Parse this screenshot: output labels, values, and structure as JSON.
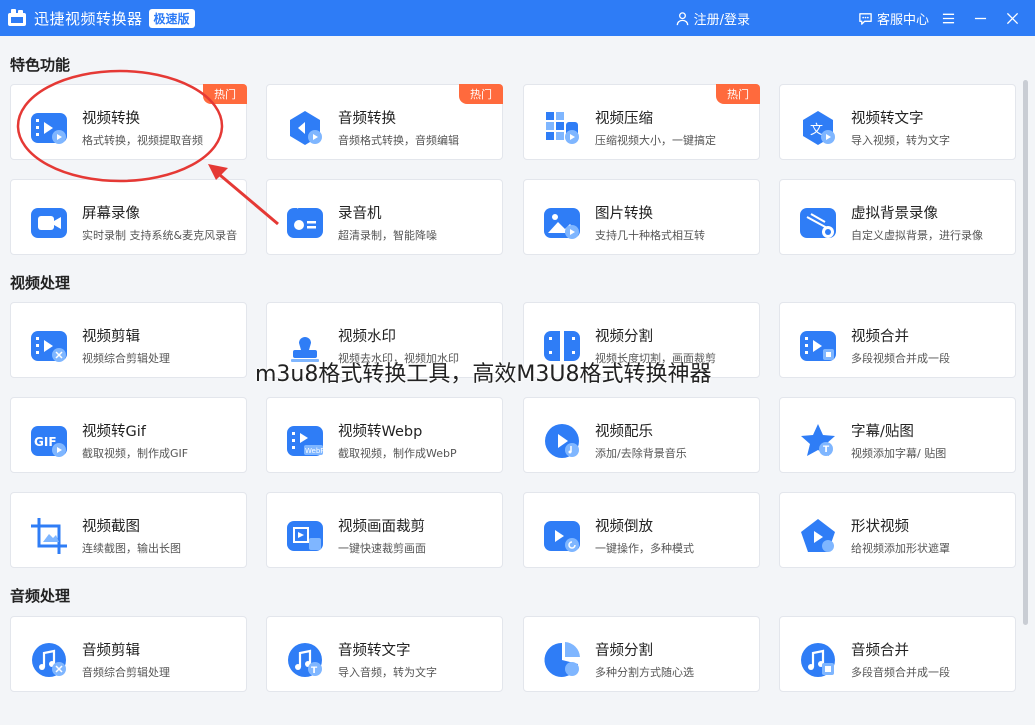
{
  "titlebar": {
    "app_title": "迅捷视频转换器",
    "edition": "极速版",
    "login": "注册/登录",
    "service": "客服中心"
  },
  "sections": {
    "featured": "特色功能",
    "video": "视频处理",
    "audio": "音频处理"
  },
  "hot_label": "热门",
  "cards": [
    {
      "name": "视频转换",
      "desc": "格式转换，视频提取音频",
      "icon": "video-convert-icon",
      "hot": true
    },
    {
      "name": "音频转换",
      "desc": "音频格式转换，音频编辑",
      "icon": "audio-convert-icon",
      "hot": true
    },
    {
      "name": "视频压缩",
      "desc": "压缩视频大小，一键搞定",
      "icon": "video-compress-icon",
      "hot": true
    },
    {
      "name": "视频转文字",
      "desc": "导入视频，转为文字",
      "icon": "video-to-text-icon",
      "hot": false
    },
    {
      "name": "屏幕录像",
      "desc": "实时录制 支持系统&麦克风录音",
      "icon": "screen-record-icon",
      "hot": false
    },
    {
      "name": "录音机",
      "desc": "超清录制，智能降噪",
      "icon": "recorder-icon",
      "hot": false
    },
    {
      "name": "图片转换",
      "desc": "支持几十种格式相互转",
      "icon": "image-convert-icon",
      "hot": false
    },
    {
      "name": "虚拟背景录像",
      "desc": "自定义虚拟背景，进行录像",
      "icon": "virtual-bg-icon",
      "hot": false
    },
    {
      "name": "视频剪辑",
      "desc": "视频综合剪辑处理",
      "icon": "video-edit-icon",
      "hot": false
    },
    {
      "name": "视频水印",
      "desc": "视频去水印，视频加水印",
      "icon": "video-watermark-icon",
      "hot": false
    },
    {
      "name": "视频分割",
      "desc": "视频长度切割，画面裁剪",
      "icon": "video-split-icon",
      "hot": false
    },
    {
      "name": "视频合并",
      "desc": "多段视频合并成一段",
      "icon": "video-merge-icon",
      "hot": false
    },
    {
      "name": "视频转Gif",
      "desc": "截取视频，制作成GIF",
      "icon": "video-to-gif-icon",
      "hot": false
    },
    {
      "name": "视频转Webp",
      "desc": "截取视频，制作成WebP",
      "icon": "video-to-webp-icon",
      "hot": false
    },
    {
      "name": "视频配乐",
      "desc": "添加/去除背景音乐",
      "icon": "video-music-icon",
      "hot": false
    },
    {
      "name": "字幕/贴图",
      "desc": "视频添加字幕/ 贴图",
      "icon": "subtitle-sticker-icon",
      "hot": false
    },
    {
      "name": "视频截图",
      "desc": "连续截图，输出长图",
      "icon": "video-screenshot-icon",
      "hot": false
    },
    {
      "name": "视频画面裁剪",
      "desc": "一键快速裁剪画面",
      "icon": "video-crop-icon",
      "hot": false
    },
    {
      "name": "视频倒放",
      "desc": "一键操作，多种模式",
      "icon": "video-reverse-icon",
      "hot": false
    },
    {
      "name": "形状视频",
      "desc": "给视频添加形状遮罩",
      "icon": "shape-video-icon",
      "hot": false
    },
    {
      "name": "音频剪辑",
      "desc": "音频综合剪辑处理",
      "icon": "audio-edit-icon",
      "hot": false
    },
    {
      "name": "音频转文字",
      "desc": "导入音频，转为文字",
      "icon": "audio-to-text-icon",
      "hot": false
    },
    {
      "name": "音频分割",
      "desc": "多种分割方式随心选",
      "icon": "audio-split-icon",
      "hot": false
    },
    {
      "name": "音频合并",
      "desc": "多段音频合并成一段",
      "icon": "audio-merge-icon",
      "hot": false
    }
  ],
  "overlay_caption": "m3u8格式转换工具，高效M3U8格式转换神器",
  "colors": {
    "titlebar": "#2e7cf6",
    "icon_blue": "#2f7df6",
    "hot_badge": "#ff6a3d",
    "annotation_red": "#e53935"
  }
}
